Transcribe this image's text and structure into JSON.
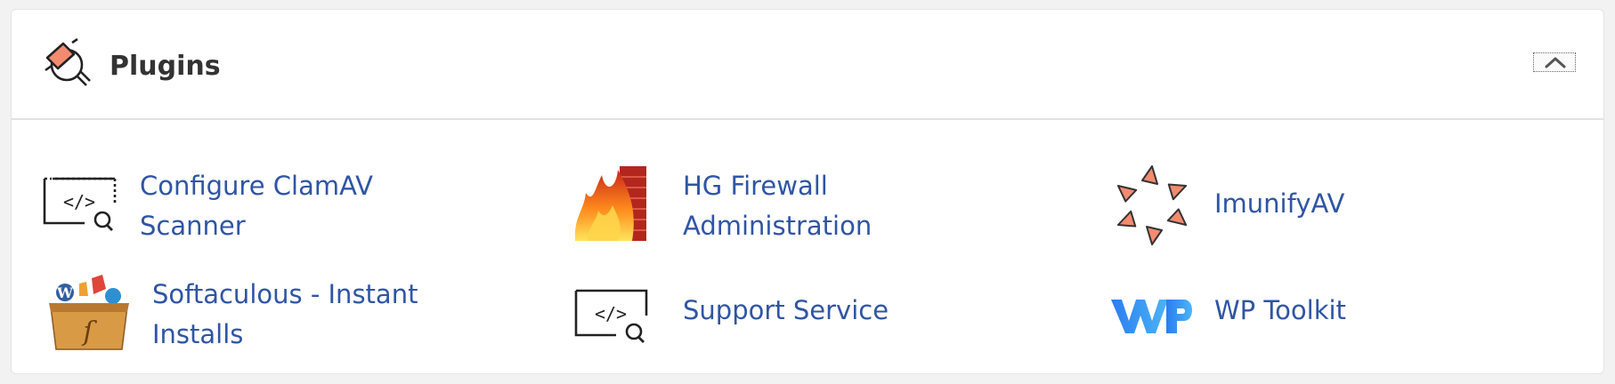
{
  "panel": {
    "title": "Plugins",
    "header_icon": "plugin-plug-icon",
    "collapse_icon": "chevron-up-icon"
  },
  "colors": {
    "link": "#2f55a4",
    "title": "#333333",
    "accent_salmon": "#f28b70"
  },
  "plugins": [
    {
      "label": "Configure ClamAV\nScanner",
      "icon": "code-search-icon"
    },
    {
      "label": "HG Firewall\nAdministration",
      "icon": "firewall-icon"
    },
    {
      "label": "ImunifyAV",
      "icon": "imunify-icon"
    },
    {
      "label": "Softaculous - Instant\nInstalls",
      "icon": "softaculous-box-icon"
    },
    {
      "label": "Support Service",
      "icon": "code-search-icon"
    },
    {
      "label": "WP Toolkit",
      "icon": "wp-toolkit-icon"
    }
  ]
}
